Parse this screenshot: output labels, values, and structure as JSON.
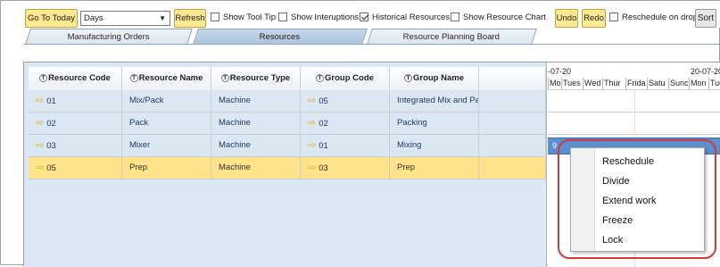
{
  "toolbar": {
    "go_to_today": "Go To Today",
    "view_select": "Days",
    "refresh": "Refresh",
    "show_tool_tip": "Show Tool Tip",
    "show_interuptions": "Show Interuptions",
    "historical_resources": "Historical Resources",
    "show_resource_chart": "Show Resource Chart",
    "undo": "Undo",
    "redo": "Redo",
    "reschedule_on_drop": "Reschedule on drop",
    "sort": "Sort",
    "checkbox_states": {
      "show_tool_tip": false,
      "show_interuptions": false,
      "historical_resources": true,
      "show_resource_chart": false,
      "reschedule_on_drop": false
    }
  },
  "tabs": [
    {
      "label": "Manufacturing Orders",
      "active": false
    },
    {
      "label": "Resources",
      "active": true
    },
    {
      "label": "Resource Planning Board",
      "active": false
    }
  ],
  "grid": {
    "columns": [
      "Resource Code",
      "Resource Name",
      "Resource Type",
      "Group Code",
      "Group Name"
    ],
    "header_icon": "T",
    "rows": [
      {
        "code": "01",
        "name": "Mix/Pack",
        "type": "Machine",
        "group_code": "05",
        "group_name": "Integrated Mix and Pa",
        "selected": false
      },
      {
        "code": "02",
        "name": "Pack",
        "type": "Machine",
        "group_code": "02",
        "group_name": "Packing",
        "selected": false
      },
      {
        "code": "03",
        "name": "Mixer",
        "type": "Machine",
        "group_code": "01",
        "group_name": "Mixing",
        "selected": false
      },
      {
        "code": "05",
        "name": "Prep",
        "type": "Machine",
        "group_code": "03",
        "group_name": "Prep",
        "selected": true
      }
    ]
  },
  "timeline": {
    "dates": [
      "-07-20",
      "20-07-20"
    ],
    "days": [
      "Mon",
      "Tues",
      "Wed",
      "Thur",
      "Frida",
      "Satu",
      "Sunc",
      "Mon",
      "Tue"
    ],
    "bar_label": "9"
  },
  "context_menu": {
    "items": [
      "Reschedule",
      "Divide",
      "Extend work",
      "Freeze",
      "Lock"
    ]
  },
  "colors": {
    "accent_button": "#fde892",
    "selected_row": "#ffe28a",
    "grid_bg": "#dbe7f3",
    "highlight": "#d23b3b",
    "task_bar": "#5b8fcf"
  }
}
